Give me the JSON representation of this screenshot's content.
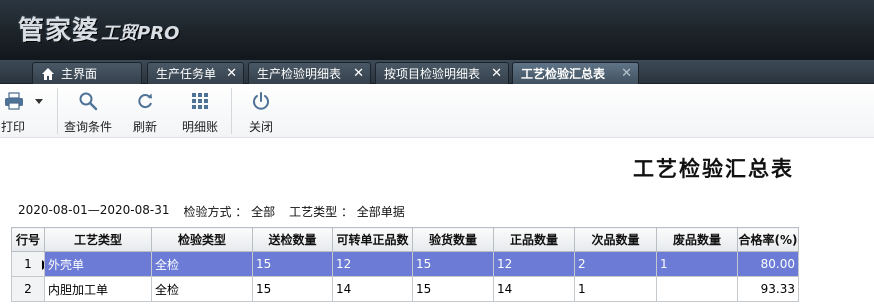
{
  "brand": {
    "name_cn": "管家婆",
    "name_sub": "工贸PRO"
  },
  "tabs": [
    {
      "label": "主界面",
      "icon": "home-icon",
      "closable": false,
      "active": false
    },
    {
      "label": "生产任务单",
      "closable": true,
      "active": false
    },
    {
      "label": "生产检验明细表",
      "closable": true,
      "active": false
    },
    {
      "label": "按项目检验明细表",
      "closable": true,
      "active": false
    },
    {
      "label": "工艺检验汇总表",
      "closable": true,
      "active": true
    }
  ],
  "toolbar": {
    "print": "打印",
    "query": "查询条件",
    "refresh": "刷新",
    "detail": "明细账",
    "close": "关闭"
  },
  "report": {
    "title": "工艺检验汇总表",
    "date_range": "2020-08-01—2020-08-31",
    "inspect_method": "检验方式 ： 全部",
    "process_type": "工艺类型 ： 全部单据"
  },
  "table": {
    "headers": [
      "行号",
      "工艺类型",
      "检验类型",
      "送检数量",
      "可转单正品数",
      "验货数量",
      "正品数量",
      "次品数量",
      "废品数量",
      "合格率(%)"
    ],
    "rows": [
      [
        "1",
        "外壳单",
        "全检",
        "15",
        "12",
        "15",
        "12",
        "2",
        "1",
        "80.00"
      ],
      [
        "2",
        "内胆加工单",
        "全检",
        "15",
        "14",
        "15",
        "14",
        "1",
        "",
        "93.33"
      ]
    ],
    "selected_row": 0
  },
  "colors": {
    "header_bg": "#1c2329",
    "selection": "#6b7bd6",
    "tab_active": "#5f7488"
  }
}
